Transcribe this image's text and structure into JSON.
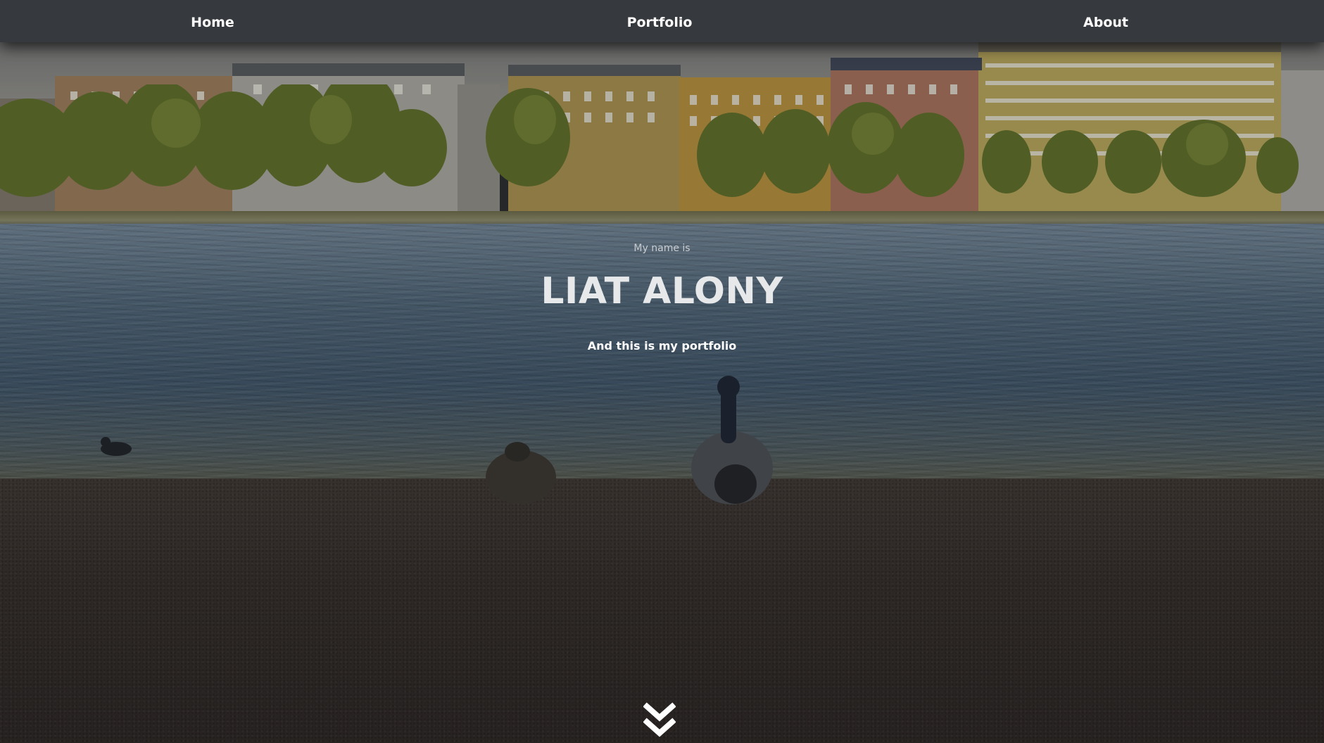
{
  "nav": {
    "items": [
      {
        "label": "Home"
      },
      {
        "label": "Portfolio"
      },
      {
        "label": "About"
      }
    ]
  },
  "hero": {
    "intro": "My name is",
    "name": "LIAT ALONY",
    "tagline": "And this is my portfolio"
  },
  "scroll_icon": "double-chevron-down",
  "colors": {
    "navbar": "#36393d",
    "nav_text": "#ffffff",
    "name_text": "#e6e8ea",
    "intro_text": "#c9cdd1"
  }
}
